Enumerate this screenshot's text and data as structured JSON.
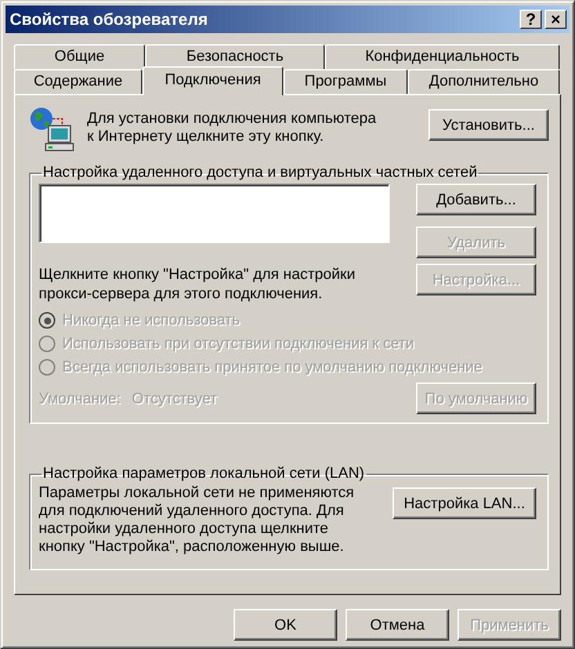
{
  "window": {
    "title": "Свойства обозревателя",
    "buttons": [
      "?",
      "×"
    ]
  },
  "tab_rows": [
    [
      {
        "label": "Общие",
        "selected": false
      },
      {
        "label": "Безопасность",
        "selected": false
      },
      {
        "label": "Конфиденциальность",
        "selected": false
      }
    ],
    [
      {
        "label": "Содержание",
        "selected": false
      },
      {
        "label": "Подключения",
        "selected": true
      },
      {
        "label": "Программы",
        "selected": false
      },
      {
        "label": "Дополнительно",
        "selected": false
      }
    ]
  ],
  "setup": {
    "text": "Для установки подключения компьютера к Интернету щелкните эту кнопку.",
    "button": {
      "label": "Установить...",
      "disabled": false
    }
  },
  "dialup": {
    "title": "Настройка удаленного доступа и виртуальных частных сетей",
    "buttons": [
      {
        "label": "Добавить...",
        "disabled": false
      },
      {
        "label": "Удалить",
        "disabled": true
      }
    ],
    "proxy_text": "Щелкните кнопку \"Настройка\" для настройки прокси-сервера для этого подключения.",
    "settings_button": {
      "label": "Настройка...",
      "disabled": true
    },
    "radios": [
      {
        "label": "Никогда не использовать",
        "selected": true,
        "disabled": true
      },
      {
        "label": "Использовать при отсутствии подключения к сети",
        "selected": false,
        "disabled": true
      },
      {
        "label": "Всегда использовать принятое по умолчанию подключение",
        "selected": false,
        "disabled": true
      }
    ],
    "default_label": "Умолчание:",
    "default_value": "Отсутствует",
    "default_disabled": true,
    "default_button": {
      "label": "По умолчанию",
      "disabled": true
    }
  },
  "lan": {
    "title": "Настройка параметров локальной сети (LAN)",
    "text": "Параметры локальной сети не применяются для подключений удаленного доступа. Для настройки удаленного доступа щелкните кнопку \"Настройка\", расположенную выше.",
    "button": {
      "label": "Настройка LAN...",
      "disabled": false
    }
  },
  "footer": [
    {
      "label": "OK",
      "disabled": false
    },
    {
      "label": "Отмена",
      "disabled": false
    },
    {
      "label": "Применить",
      "disabled": true
    }
  ]
}
